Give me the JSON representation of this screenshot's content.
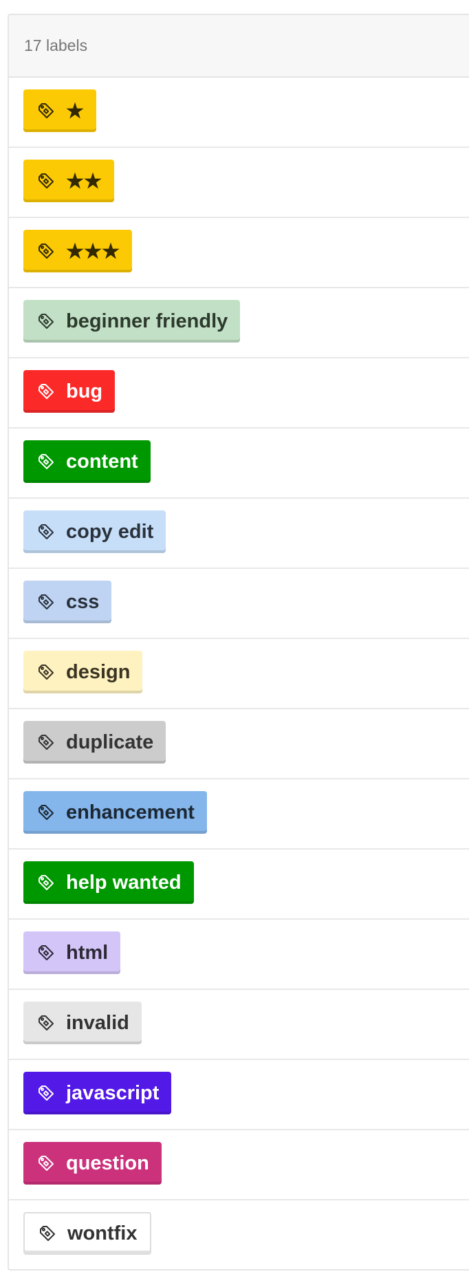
{
  "header": {
    "count_text": "17 labels"
  },
  "labels": [
    {
      "name": "★",
      "bg": "#fbca04",
      "fg": "#332900"
    },
    {
      "name": "★★",
      "bg": "#fbca04",
      "fg": "#332900"
    },
    {
      "name": "★★★",
      "bg": "#fbca04",
      "fg": "#332900"
    },
    {
      "name": "beginner friendly",
      "bg": "#c2e0c6",
      "fg": "#2c3a2d"
    },
    {
      "name": "bug",
      "bg": "#fc2929",
      "fg": "#ffffff"
    },
    {
      "name": "content",
      "bg": "#009800",
      "fg": "#ffffff"
    },
    {
      "name": "copy edit",
      "bg": "#c7def8",
      "fg": "#2a323c"
    },
    {
      "name": "css",
      "bg": "#bfd4f2",
      "fg": "#29313c"
    },
    {
      "name": "design",
      "bg": "#fef2c0",
      "fg": "#3a3424"
    },
    {
      "name": "duplicate",
      "bg": "#cccccc",
      "fg": "#333333"
    },
    {
      "name": "enhancement",
      "bg": "#84b6eb",
      "fg": "#1c2733"
    },
    {
      "name": "help wanted",
      "bg": "#009800",
      "fg": "#ffffff"
    },
    {
      "name": "html",
      "bg": "#d4c5f9",
      "fg": "#2d2a37"
    },
    {
      "name": "invalid",
      "bg": "#e6e6e6",
      "fg": "#333333"
    },
    {
      "name": "javascript",
      "bg": "#5319e7",
      "fg": "#ffffff"
    },
    {
      "name": "question",
      "bg": "#cc317c",
      "fg": "#ffffff"
    },
    {
      "name": "wontfix",
      "bg": "#ffffff",
      "fg": "#333333"
    }
  ],
  "icons": {
    "label": "tag-icon"
  }
}
